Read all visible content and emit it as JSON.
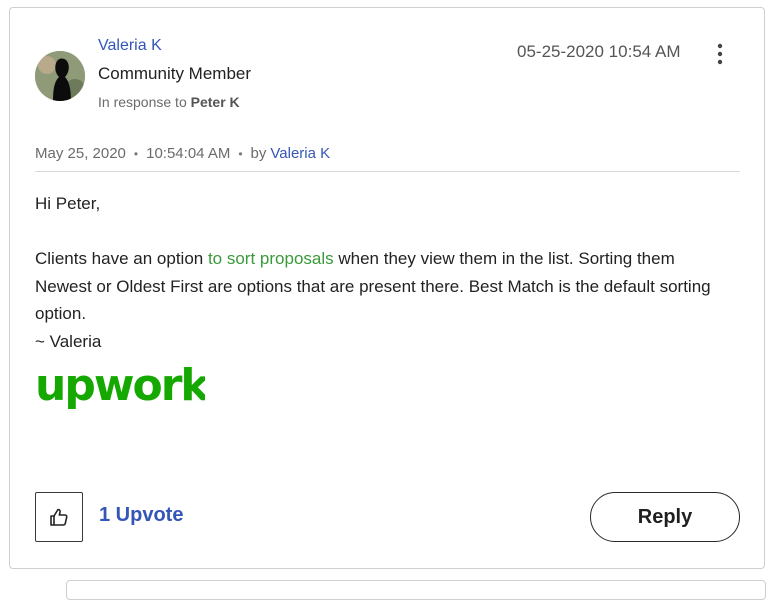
{
  "post": {
    "author": "Valeria K",
    "rank": "Community Member",
    "in_response_prefix": "In response to",
    "in_response_to": "Peter K",
    "posted_datetime": "05-25-2020 10:54 AM",
    "meta_date": "May 25, 2020",
    "meta_time": "10:54:04 AM",
    "meta_by": "by",
    "meta_author": "Valeria K"
  },
  "body": {
    "greeting": "Hi Peter,",
    "line1_before": "Clients have an option ",
    "line1_link": "to sort proposals",
    "line1_after": " when they view them in the list. Sorting them Newest or Oldest First are options that are present there. Best Match is the default sorting option.",
    "signature": "~ Valeria",
    "logo_text": "upwork"
  },
  "actions": {
    "upvote_count": "1 Upvote",
    "reply_label": "Reply"
  },
  "icons": {
    "menu": "kebab-vertical-icon",
    "upvote": "thumbs-up-icon"
  },
  "colors": {
    "link_blue": "#3456b8",
    "link_green": "#3b9a3b",
    "brand_green": "#14a800"
  }
}
